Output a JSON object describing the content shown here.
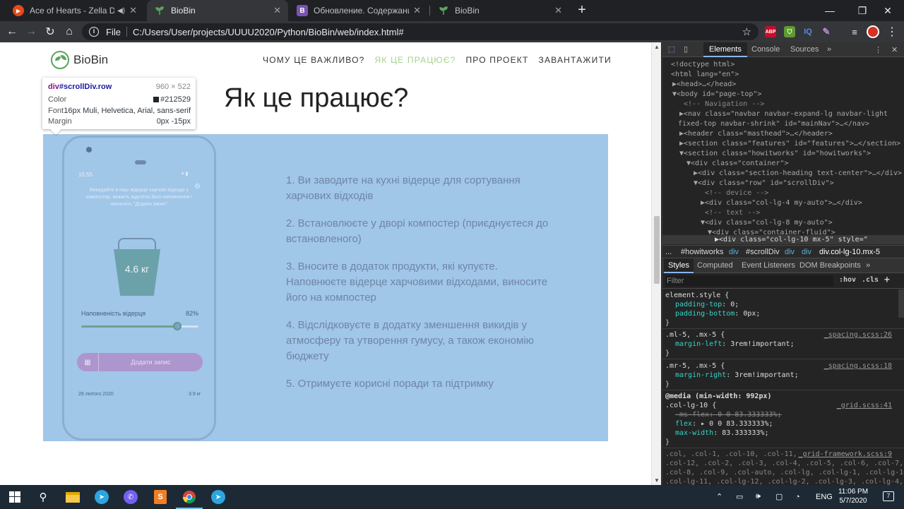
{
  "browser": {
    "tabs": [
      {
        "title": "Ace of Hearts - Zella Day - G",
        "icon": "youtube-music-icon",
        "color": "#e64a19",
        "extra_icons": [
          "speaker-icon"
        ]
      },
      {
        "title": "BioBin",
        "icon": "biobin-leaf-icon",
        "color": "#5aa55e"
      },
      {
        "title": "Обновление. Содержание - Boo",
        "icon": "bootstrap-icon",
        "color": "#7952b3"
      },
      {
        "title": "BioBin",
        "icon": "biobin-leaf-icon",
        "color": "#5aa55e"
      }
    ],
    "active_tab": 1,
    "address": {
      "scheme": "File",
      "url": "C:/Users/User/projects/UUUU2020/Python/BioBin/web/index.html#"
    },
    "extensions": [
      {
        "name": "adblock-plus-icon",
        "label": "ABP",
        "color": "#c70d2c"
      },
      {
        "name": "shield-icon",
        "label": "",
        "color": "#5f9b2f"
      },
      {
        "name": "iq-icon",
        "label": "IQ",
        "color": "#4a90e2"
      },
      {
        "name": "feather-icon",
        "label": "",
        "color": "#b889d3"
      }
    ]
  },
  "site": {
    "brand": "BioBin",
    "nav": [
      "ЧОМУ ЦЕ ВАЖЛИВО?",
      "ЯК ЦЕ ПРАЦЮЄ?",
      "ПРО ПРОЕКТ",
      "ЗАВАНТАЖИТИ"
    ],
    "nav_active": 1,
    "section_title": "Як це працює?",
    "steps": [
      "1. Ви заводите на кухні відерце для сортування харчових відходів",
      "2. Встановлюєте у дворі компостер (приєднуєтеся до встановленого)",
      "3. Вносите в додаток продукти, які купуєте. Наповнюєте відерце харчовими відходами, виносите його на компостер",
      "4. Відслідковуєте в додатку зменшення викидів у атмосферу та утворення гумусу, а також економію бюджету",
      "5. Отримуєте корисні поради та підтримку"
    ],
    "phone": {
      "time": "15:55",
      "hint": "Викидайте в наш відерце харчові відходи у компостер, вкажіть відсоток його наповнення і натисніть \"Додати запис\"",
      "bucket_label": "4.6 кг",
      "fill_label": "Наповненість відерця",
      "fill_value": "82%",
      "fill_fraction": 0.82,
      "add_button": "Додати запис",
      "entry_date": "28 лютого 2020",
      "entry_value": "3.9 кг"
    }
  },
  "inspect_tooltip": {
    "selector_tag": "div",
    "selector_rest": "#scrollDiv.row",
    "dimensions": "960 × 522",
    "color_label": "Color",
    "color_value": "#212529",
    "font_label": "Font",
    "font_value": "16px Muli, Helvetica, Arial, sans-serif",
    "margin_label": "Margin",
    "margin_value": "0px -15px"
  },
  "devtools": {
    "tabs": [
      "Elements",
      "Console",
      "Sources",
      "»"
    ],
    "active_tab": "Elements",
    "dom_lines": [
      {
        "t": "<!doctype html>"
      },
      {
        "t": "<html lang=\"en\">"
      },
      {
        "t": "▶<head>…</head>"
      },
      {
        "t": "▼<body id=\"page-top\">"
      },
      {
        "t": "<!-- Navigation -->"
      },
      {
        "t": "▶<nav class=\"navbar navbar-expand-lg navbar-light"
      },
      {
        "t": "fixed-top navbar-shrink\" id=\"mainNav\">…</nav>"
      },
      {
        "t": "▶<header class=\"masthead\">…</header>"
      },
      {
        "t": "▶<section class=\"features\" id=\"features\">…</section>"
      },
      {
        "t": "▼<section class=\"howitworks\" id=\"howitworks\">"
      },
      {
        "t": "▼<div class=\"container\">"
      },
      {
        "t": "▶<div class=\"section-heading text-center\">…</div>"
      },
      {
        "t": "▼<div class=\"row\" id=\"scrollDiv\">"
      },
      {
        "t": "<!-- device -->"
      },
      {
        "t": "▶<div class=\"col-lg-4 my-auto\">…</div>"
      },
      {
        "t": "<!-- text -->"
      },
      {
        "t": "▼<div class=\"col-lg-8 my-auto\">"
      },
      {
        "t": "▼<div class=\"container-fluid\">"
      },
      {
        "t": "▶<div class=\"col-lg-10 mx-5\" style=\""
      }
    ],
    "breadcrumbs": [
      "...",
      "#howitworks",
      "div",
      "#scrollDiv",
      "div",
      "div",
      "div.col-lg-10.mx-5"
    ],
    "subtabs": [
      "Styles",
      "Computed",
      "Event Listeners",
      "DOM Breakpoints",
      "»"
    ],
    "filter_placeholder": "Filter",
    "filter_options": [
      ":hov",
      ".cls",
      "+"
    ],
    "styles": [
      {
        "selector": "element.style {",
        "source": "",
        "props": [
          [
            "padding-top",
            "0;"
          ],
          [
            "padding-bottom",
            "0px;"
          ]
        ]
      },
      {
        "selector": ".ml-5, .mx-5 {",
        "source": "_spacing.scss:26",
        "props": [
          [
            "margin-left",
            "3rem!important;"
          ]
        ]
      },
      {
        "selector": ".mr-5, .mx-5 {",
        "source": "_spacing.scss:18",
        "props": [
          [
            "margin-right",
            "3rem!important;"
          ]
        ]
      },
      {
        "selector": "@media (min-width: 992px)",
        "selector2": ".col-lg-10 {",
        "source": "_grid.scss:41",
        "props": [
          [
            "-ms-flex",
            "0 0 83.333333%;"
          ],
          [
            "flex",
            "▸ 0 0 83.333333%;"
          ],
          [
            "max-width",
            "83.333333%;"
          ]
        ]
      },
      {
        "selector": ".col, .col-1, .col-10, .col-11,",
        "source": "_grid-framework.scss:9",
        "more": [
          ".col-12, .col-2, .col-3, .col-4, .col-5, .col-6, .col-7,",
          ".col-8, .col-9, .col-auto, .col-lg, .col-lg-1, .col-lg-10,",
          ".col-lg-11, .col-lg-12, .col-lg-2, .col-lg-3, .col-lg-4,"
        ]
      }
    ]
  },
  "taskbar": {
    "apps": [
      "windows-start-icon",
      "search-icon",
      "file-explorer-icon",
      "telegram-icon",
      "viber-icon",
      "sublime-text-icon",
      "chrome-icon",
      "telegram-desktop-icon"
    ],
    "active_app": "chrome-icon",
    "language": "ENG",
    "time": "11:06 PM",
    "date": "5/7/2020",
    "notifications": "7"
  }
}
